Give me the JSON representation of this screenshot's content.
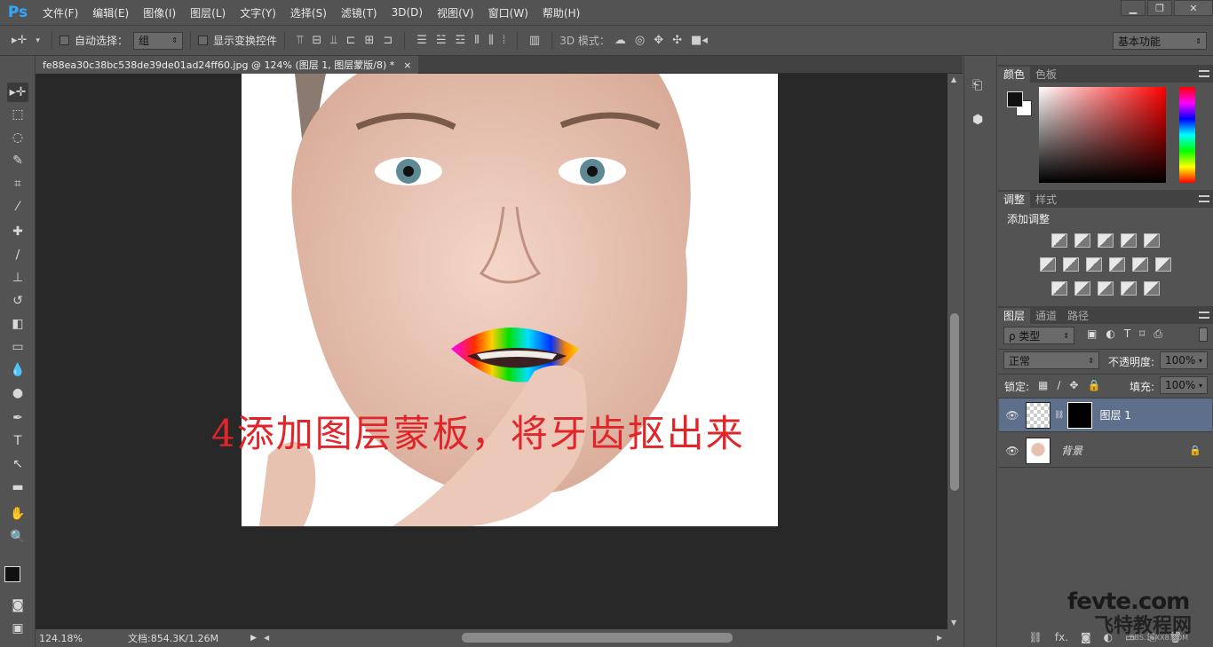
{
  "app": {
    "logo": "Ps"
  },
  "menu": [
    "文件(F)",
    "编辑(E)",
    "图像(I)",
    "图层(L)",
    "文字(Y)",
    "选择(S)",
    "滤镜(T)",
    "3D(D)",
    "视图(V)",
    "窗口(W)",
    "帮助(H)"
  ],
  "window_controls": {
    "minimize": "▁",
    "restore": "❐",
    "close": "✕"
  },
  "options": {
    "auto_select_label": "自动选择：",
    "auto_select_value": "组",
    "show_transform_label": "显示变换控件",
    "mode_3d_label": "3D 模式：",
    "workspace": "基本功能"
  },
  "document": {
    "tab_title": "fe88ea30c38bc538de39de01ad24ff60.jpg @ 124% (图层 1, 图层蒙版/8) *",
    "close": "×",
    "annotation": "4添加图层蒙板，将牙齿抠出来",
    "zoom": "124.18%",
    "doc_size": "文档:854.3K/1.26M"
  },
  "color_panel": {
    "tabs": [
      "颜色",
      "色板"
    ]
  },
  "adjust_panel": {
    "tabs": [
      "调整",
      "样式"
    ],
    "title": "添加调整"
  },
  "layers_panel": {
    "tabs": [
      "图层",
      "通道",
      "路径"
    ],
    "filter_label": "ρ 类型",
    "blend_mode": "正常",
    "opacity_label": "不透明度:",
    "opacity_value": "100%",
    "lock_label": "锁定:",
    "fill_label": "填充:",
    "fill_value": "100%",
    "layers": [
      {
        "name": "图层 1",
        "selected": true
      },
      {
        "name": "背景",
        "locked": true
      }
    ]
  },
  "watermark": {
    "line1": "fevte.com",
    "line2": "飞特教程网",
    "line3": "BBS.16XX8.COM"
  }
}
